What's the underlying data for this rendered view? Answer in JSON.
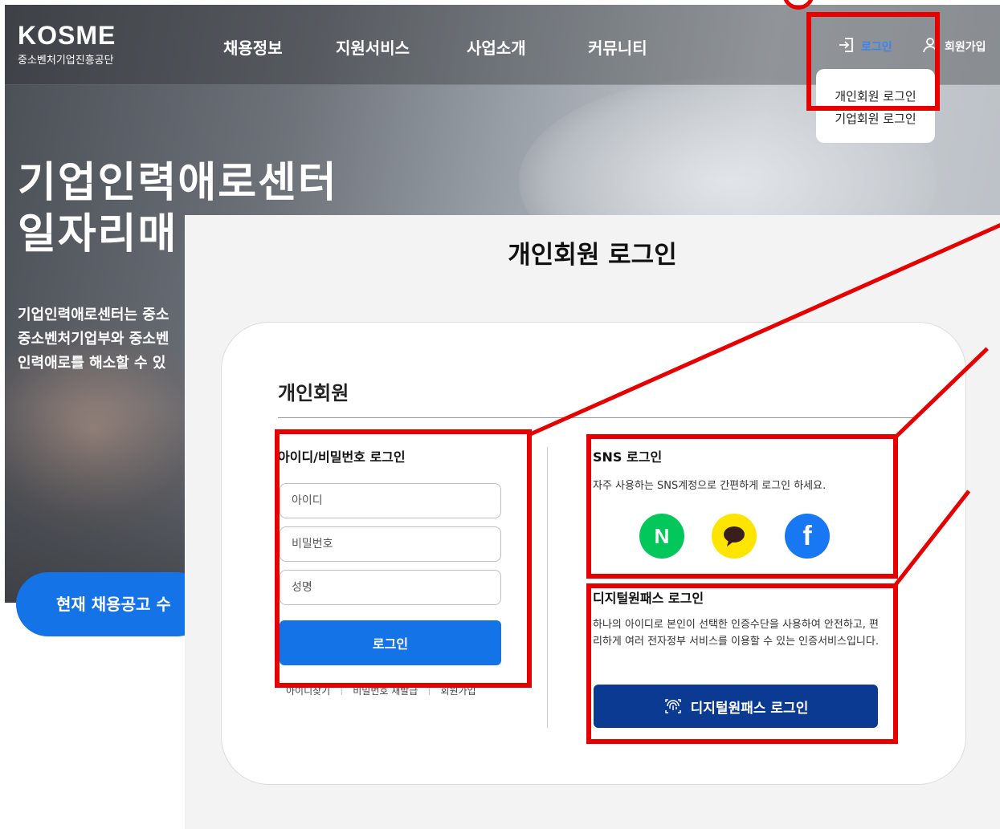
{
  "site": {
    "logo_main": "KOSME",
    "logo_sub": "중소벤처기업진흥공단",
    "nav": [
      "채용정보",
      "지원서비스",
      "사업소개",
      "커뮤니티"
    ],
    "login_label": "로그인",
    "signup_label": "회원가입",
    "dropdown": [
      "개인회원 로그인",
      "기업회원 로그인"
    ],
    "hero_line1": "기업인력애로센터",
    "hero_line2": "일자리매",
    "hero_desc1": "기업인력애로센터는 중소",
    "hero_desc2": "중소벤처기업부와 중소벤",
    "hero_desc3": "인력애로를 해소할 수 있",
    "jobs_pill": "현재 채용공고 수"
  },
  "login": {
    "page_title": "개인회원 로그인",
    "section_title": "개인회원",
    "id_pw": {
      "heading": "아이디/비밀번호 로그인",
      "id_placeholder": "아이디",
      "pw_placeholder": "비밀번호",
      "name_placeholder": "성명",
      "button": "로그인",
      "links": [
        "아이디찾기",
        "비밀번호 재발급",
        "회원가입"
      ]
    },
    "sns": {
      "heading": "SNS 로그인",
      "desc": "자주 사용하는 SNS계정으로 간편하게 로그인 하세요.",
      "icons": [
        {
          "name": "naver-icon",
          "glyph": "N",
          "color": "#03c75a"
        },
        {
          "name": "kakao-icon",
          "glyph": "",
          "color": "#fee500"
        },
        {
          "name": "facebook-icon",
          "glyph": "f",
          "color": "#1877f2"
        }
      ]
    },
    "digital_onepass": {
      "heading": "디지털원패스 로그인",
      "desc": "하나의 아이디로 본인이 선택한 인증수단을 사용하여 안전하고, 편리하게 여러 전자정부 서비스를 이용할 수 있는 인증서비스입니다.",
      "button": "디지털원패스 로그인"
    }
  },
  "colors": {
    "primary_blue": "#1473e6",
    "onepass_navy": "#0b3a92",
    "annotation_red": "#e60000"
  }
}
